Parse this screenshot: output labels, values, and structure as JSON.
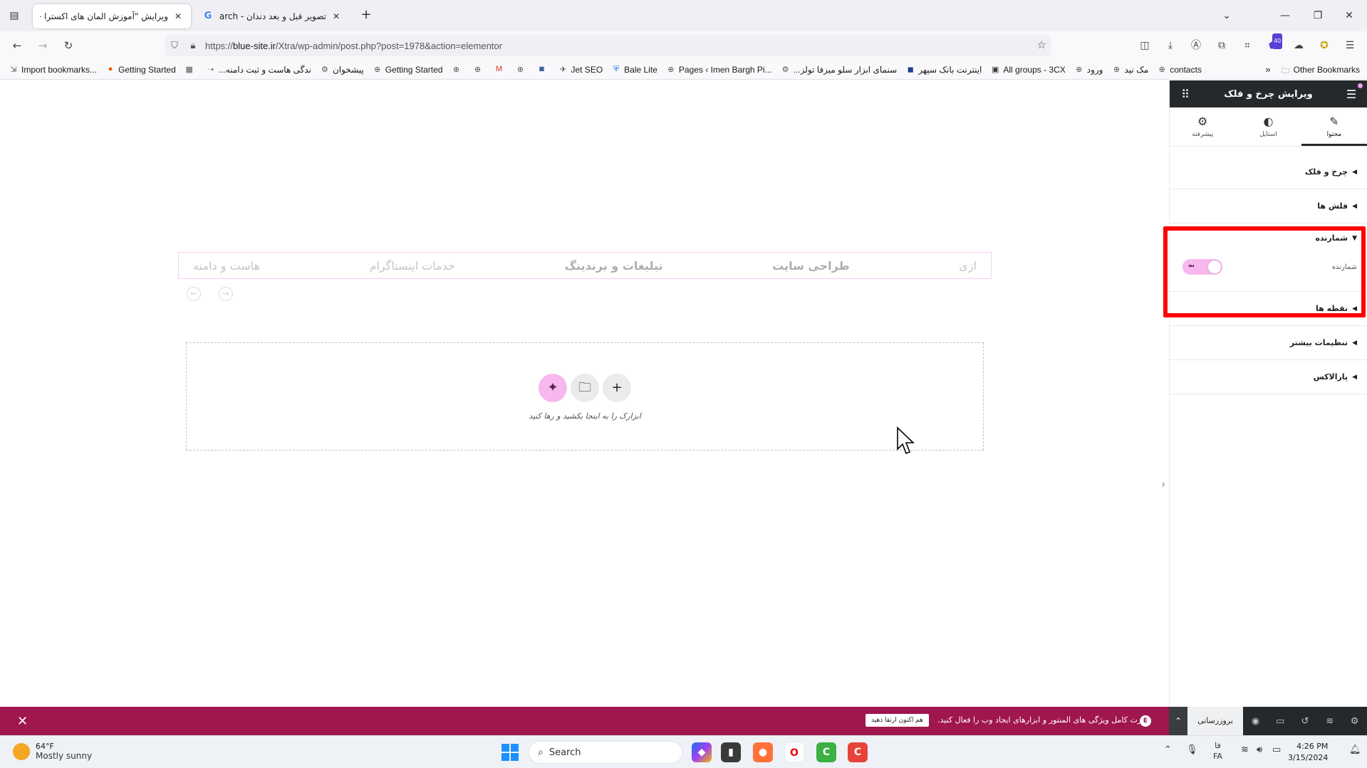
{
  "browser": {
    "tabs": [
      {
        "title": "ویرایش \"آموزش المان های اکسترا – ها",
        "active": true
      },
      {
        "title": "تصویر قبل و بعد دندان - Search",
        "active": false
      }
    ],
    "url_prefix": "https://",
    "url_host": "blue-site.ir",
    "url_path": "/Xtra/wp-admin/post.php?post=1978&action=elementor",
    "bookmarks": [
      "Import bookmarks...",
      "Getting Started",
      "...ندگی هاست و ثبت دامنه",
      "پیشخوان",
      "Getting Started",
      "Jet SEO",
      "Bale Lite",
      "Pages ‹ Imen Bargh Pi...",
      "...سنمای ابزار سلو میزفا تولز",
      "اینترنت بانک سپهر",
      "All groups - 3CX",
      "ورود",
      "مک نید",
      "contacts"
    ],
    "other_bookmarks": "Other Bookmarks",
    "extension_badge": "40"
  },
  "canvas": {
    "nav_items": [
      "ازی",
      "طراحی سایت",
      "تبلیغات و برندینگ",
      "خدمات اینستاگرام",
      "هاست و دامنه"
    ],
    "drop_text": "ابزارک را به اینجا بکشید و رها کنید"
  },
  "panel": {
    "title": "ویرایش چرخ و فلک",
    "tabs": [
      {
        "label": "محتوا",
        "icon": "pencil-icon"
      },
      {
        "label": "استایل",
        "icon": "contrast-icon"
      },
      {
        "label": "پیشرفته",
        "icon": "gear-icon"
      }
    ],
    "sections": {
      "carousel": "چرخ و فلک",
      "arrows": "فلش ها",
      "counter": "شمارنده",
      "dots": "نقطه ها",
      "more_settings": "تنظیمات بیشتر",
      "parallax": "پارالاکس"
    },
    "counter_label": "شمارنده",
    "counter_toggle": "نه"
  },
  "notice": {
    "message": "قدرت کامل ویژگی های المنتور و ابزارهای ایجاد وب را فعال کنید.",
    "button": "هم اکنون ارتقا دهید"
  },
  "footer": {
    "update_label": "بروزرسانی"
  },
  "taskbar": {
    "temperature": "64°F",
    "weather": "Mostly sunny",
    "search_placeholder": "Search",
    "lang_top": "فا",
    "lang_bottom": "FA",
    "time": "4:26 PM",
    "date": "3/15/2024"
  }
}
